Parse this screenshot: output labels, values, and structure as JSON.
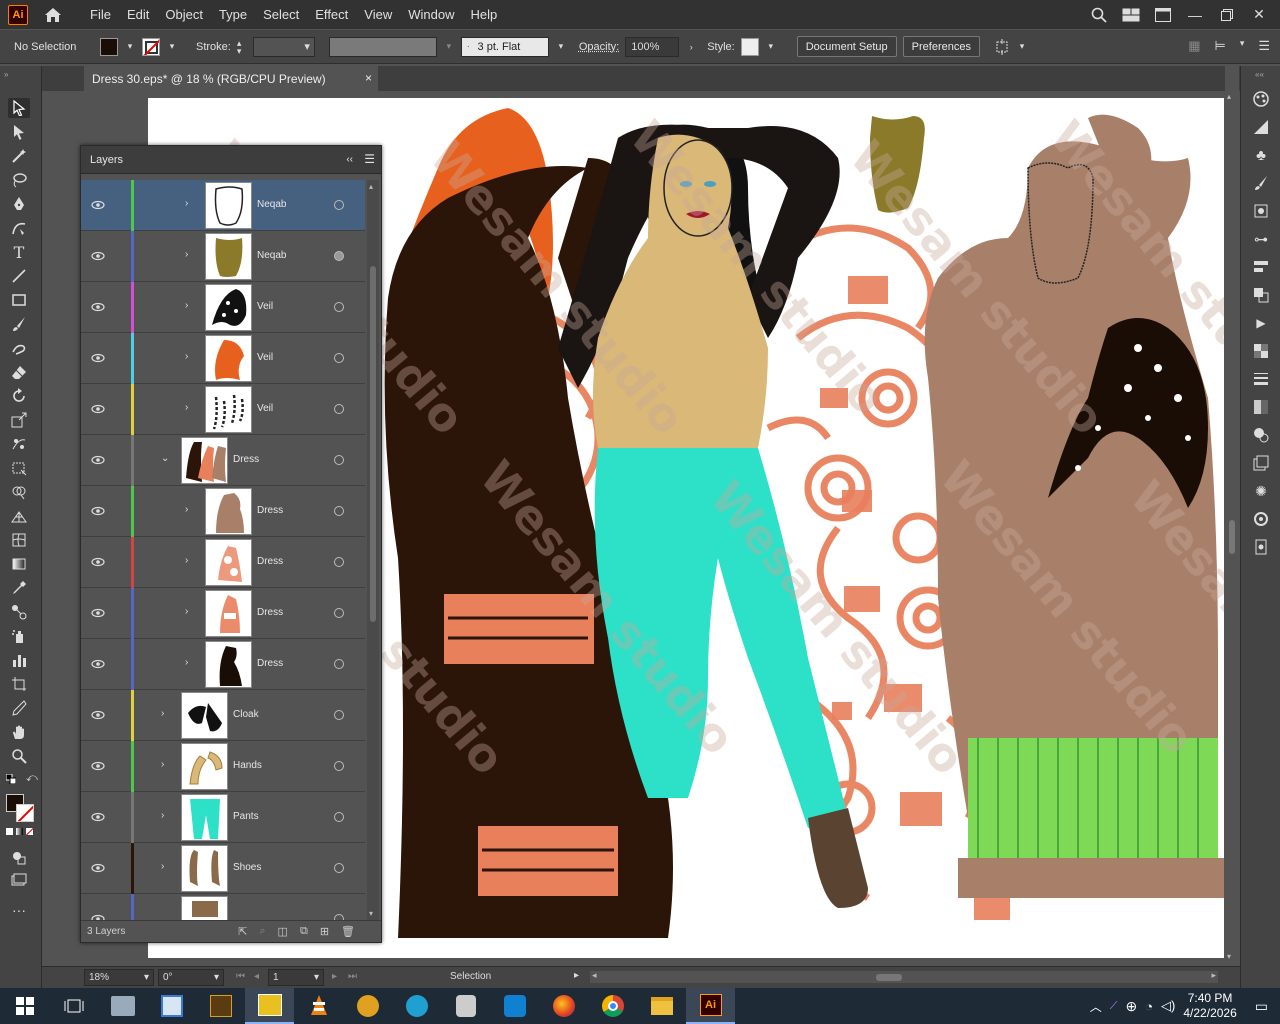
{
  "app": {
    "logo_text": "Ai",
    "menu": [
      "File",
      "Edit",
      "Object",
      "Type",
      "Select",
      "Effect",
      "View",
      "Window",
      "Help"
    ]
  },
  "control_bar": {
    "selection_label": "No Selection",
    "stroke_label": "Stroke:",
    "brush_value": "3 pt. Flat",
    "opacity_label": "Opacity:",
    "opacity_value": "100%",
    "style_label": "Style:",
    "document_setup": "Document Setup",
    "preferences": "Preferences"
  },
  "document": {
    "tab_title": "Dress 30.eps* @ 18 % (RGB/CPU Preview)",
    "close_glyph": "×"
  },
  "layers_panel": {
    "title": "Layers",
    "footer_count": "3 Layers",
    "rows": [
      {
        "name": "Neqab",
        "color": "#4fc74f",
        "level": 1,
        "selected": true,
        "target_filled": false,
        "thumb": "neqab-outline",
        "chev": "›"
      },
      {
        "name": "Neqab",
        "color": "#5566c9",
        "level": 1,
        "selected": false,
        "target_filled": true,
        "thumb": "neqab-olive",
        "chev": "›"
      },
      {
        "name": "Veil",
        "color": "#d44fd4",
        "level": 1,
        "selected": false,
        "target_filled": false,
        "thumb": "veil-black",
        "chev": "›"
      },
      {
        "name": "Veil",
        "color": "#4fd0e0",
        "level": 1,
        "selected": false,
        "target_filled": false,
        "thumb": "veil-orange",
        "chev": "›"
      },
      {
        "name": "Veil",
        "color": "#e0d040",
        "level": 1,
        "selected": false,
        "target_filled": false,
        "thumb": "veil-braids",
        "chev": "›"
      },
      {
        "name": "Dress",
        "color": "#777777",
        "level": 0,
        "selected": false,
        "target_filled": false,
        "thumb": "dress-group",
        "chev": "⌄"
      },
      {
        "name": "Dress",
        "color": "#4fc74f",
        "level": 1,
        "selected": false,
        "target_filled": false,
        "thumb": "dress-tan",
        "chev": "›"
      },
      {
        "name": "Dress",
        "color": "#d44444",
        "level": 1,
        "selected": false,
        "target_filled": false,
        "thumb": "dress-orn",
        "chev": "›"
      },
      {
        "name": "Dress",
        "color": "#5566c9",
        "level": 1,
        "selected": false,
        "target_filled": false,
        "thumb": "dress-orn2",
        "chev": "›"
      },
      {
        "name": "Dress",
        "color": "#5566c9",
        "level": 1,
        "selected": false,
        "target_filled": false,
        "thumb": "dress-black",
        "chev": "›"
      },
      {
        "name": "Cloak",
        "color": "#e0d040",
        "level": 0,
        "selected": false,
        "target_filled": false,
        "thumb": "cloak",
        "chev": "›"
      },
      {
        "name": "Hands",
        "color": "#4fc74f",
        "level": 0,
        "selected": false,
        "target_filled": false,
        "thumb": "hands",
        "chev": "›"
      },
      {
        "name": "Pants",
        "color": "#777777",
        "level": 0,
        "selected": false,
        "target_filled": false,
        "thumb": "pants",
        "chev": "›"
      },
      {
        "name": "Shoes",
        "color": "#2b1509",
        "level": 0,
        "selected": false,
        "target_filled": false,
        "thumb": "shoes",
        "chev": "›"
      },
      {
        "name": "",
        "color": "#5566c9",
        "level": 0,
        "selected": false,
        "target_filled": false,
        "thumb": "partial",
        "chev": ""
      }
    ]
  },
  "status_bar": {
    "zoom": "18%",
    "rotation": "0°",
    "artboard_number": "1",
    "tool": "Selection"
  },
  "watermark": "Wesam studio",
  "taskbar": {
    "time": "7:40 PM",
    "date": "4/22/2026"
  },
  "colors": {
    "accent": "#46607f",
    "dress_brown": "#2b1509",
    "ornament_orange": "#e8805c",
    "hair_orange": "#e8601e",
    "pants_teal": "#2de0c8",
    "skin_tan": "#d9b878",
    "robe_tan": "#a8806a",
    "hem_green": "#7ed957"
  }
}
